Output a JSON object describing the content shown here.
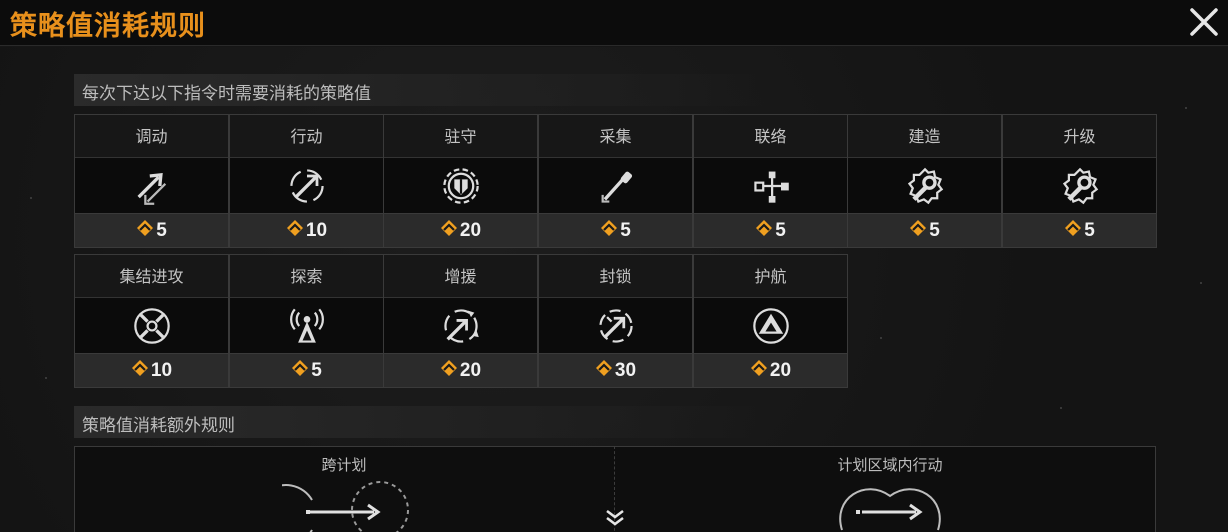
{
  "header": {
    "title": "策略值消耗规则"
  },
  "section1": {
    "heading": "每次下达以下指令时需要消耗的策略值"
  },
  "section2": {
    "heading": "策略值消耗额外规则"
  },
  "commands": [
    {
      "label": "调动",
      "cost": "5",
      "icon": "move-arrow-icon"
    },
    {
      "label": "行动",
      "cost": "10",
      "icon": "action-target-icon"
    },
    {
      "label": "驻守",
      "cost": "20",
      "icon": "garrison-shield-icon"
    },
    {
      "label": "采集",
      "cost": "5",
      "icon": "gather-shovel-icon"
    },
    {
      "label": "联络",
      "cost": "5",
      "icon": "network-icon"
    },
    {
      "label": "建造",
      "cost": "5",
      "icon": "build-wrench-icon"
    },
    {
      "label": "升级",
      "cost": "5",
      "icon": "upgrade-wrench-icon"
    },
    {
      "label": "集结进攻",
      "cost": "10",
      "icon": "rally-attack-icon"
    },
    {
      "label": "探索",
      "cost": "5",
      "icon": "explore-signal-icon"
    },
    {
      "label": "增援",
      "cost": "20",
      "icon": "reinforce-icon"
    },
    {
      "label": "封锁",
      "cost": "30",
      "icon": "blockade-icon"
    },
    {
      "label": "护航",
      "cost": "20",
      "icon": "escort-icon"
    }
  ],
  "extra_rules": [
    {
      "label": "跨计划",
      "icon": "cross-plan-icon"
    },
    {
      "label": "计划区域内行动",
      "icon": "in-plan-area-icon"
    }
  ],
  "colors": {
    "accent": "#e8901c",
    "cost_icon": "#f0a020"
  }
}
